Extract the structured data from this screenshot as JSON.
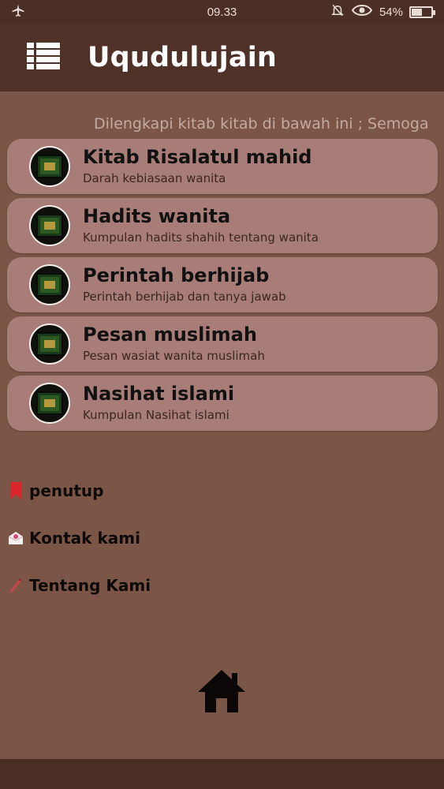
{
  "status": {
    "time": "09.33",
    "battery_percent_label": "54%",
    "battery_level": 0.54
  },
  "appbar": {
    "title": "Uqudulujain",
    "menu_icon": "list-icon"
  },
  "marquee_text": "Dilengkapi kitab kitab di bawah ini ; Semoga",
  "books": [
    {
      "title": "Kitab Risalatul mahid",
      "subtitle": "Darah kebiasaan wanita"
    },
    {
      "title": "Hadits wanita",
      "subtitle": "Kumpulan hadits shahih tentang wanita"
    },
    {
      "title": "Perintah berhijab",
      "subtitle": "Perintah berhijab dan tanya jawab"
    },
    {
      "title": "Pesan muslimah",
      "subtitle": "Pesan wasiat wanita muslimah"
    },
    {
      "title": "Nasihat islami",
      "subtitle": "Kumpulan Nasihat islami"
    }
  ],
  "drawer": [
    {
      "label": "penutup",
      "icon": "bookmark-icon"
    },
    {
      "label": "Kontak kami",
      "icon": "mail-icon"
    },
    {
      "label": "Tentang Kami",
      "icon": "pencil-icon"
    }
  ],
  "colors": {
    "statusbar": "#4b2f26",
    "appbar": "#4f3128",
    "background": "#7b5646",
    "card": "#a87d77",
    "bookmark": "#d8242b"
  }
}
